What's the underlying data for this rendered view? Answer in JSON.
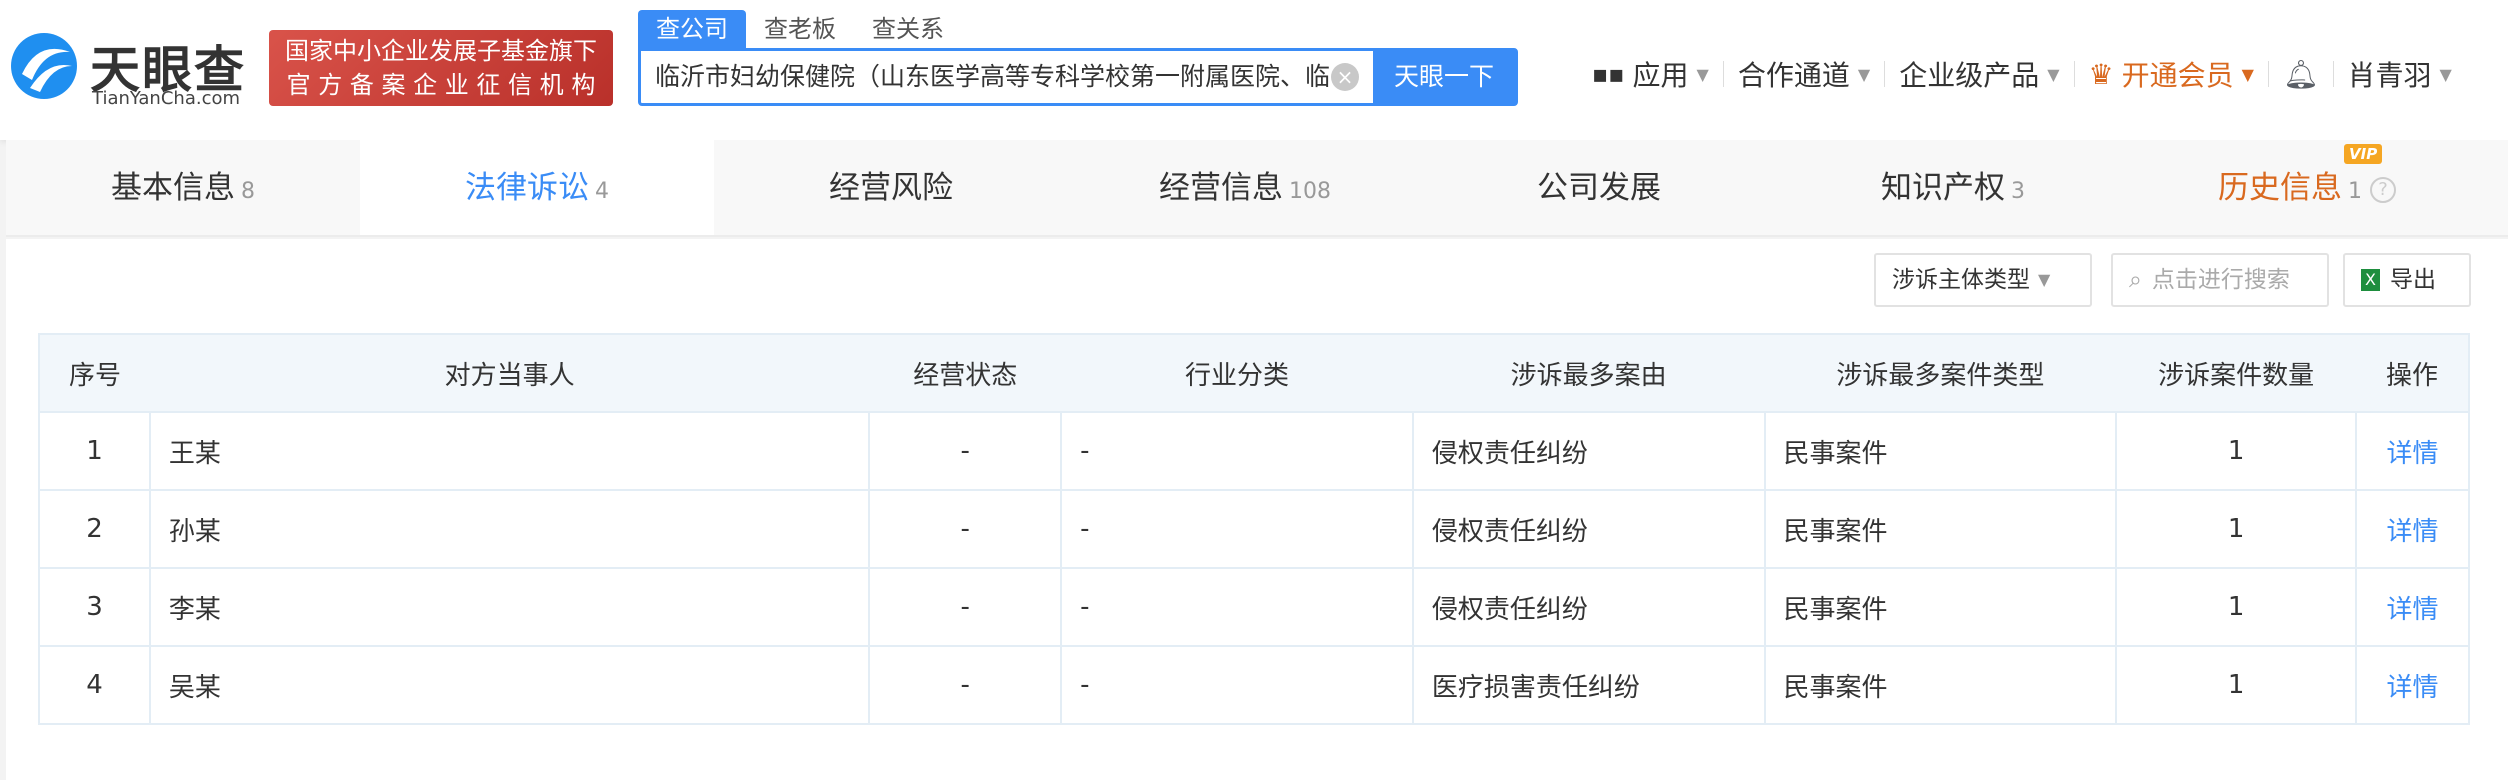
{
  "header": {
    "logo_text": "天眼查",
    "logo_url": "TianYanCha.com",
    "badge_line1": "国家中小企业发展子基金旗下",
    "badge_line2": "官 方 备 案 企 业 征 信 机 构",
    "search_tabs": [
      "查公司",
      "查老板",
      "查关系"
    ],
    "search_value": "临沂市妇幼保健院（山东医学高等专科学校第一附属医院、临沂",
    "search_button": "天眼一下",
    "nav": {
      "apps": "应用",
      "partner": "合作通道",
      "enterprise": "企业级产品",
      "vip": "开通会员",
      "user": "肖青羽"
    }
  },
  "tabs": [
    {
      "label": "基本信息",
      "count": "8"
    },
    {
      "label": "法律诉讼",
      "count": "4"
    },
    {
      "label": "经营风险",
      "count": ""
    },
    {
      "label": "经营信息",
      "count": "108"
    },
    {
      "label": "公司发展",
      "count": ""
    },
    {
      "label": "知识产权",
      "count": "3"
    },
    {
      "label": "历史信息",
      "count": "1",
      "badge": "VIP"
    }
  ],
  "toolbar": {
    "filter": "涉诉主体类型",
    "search_placeholder": "点击进行搜索",
    "export": "导出"
  },
  "table": {
    "headers": [
      "序号",
      "对方当事人",
      "经营状态",
      "行业分类",
      "涉诉最多案由",
      "涉诉最多案件类型",
      "涉诉案件数量",
      "操作"
    ],
    "rows": [
      [
        "1",
        "王某",
        "-",
        "-",
        "侵权责任纠纷",
        "民事案件",
        "1",
        "详情"
      ],
      [
        "2",
        "孙某",
        "-",
        "-",
        "侵权责任纠纷",
        "民事案件",
        "1",
        "详情"
      ],
      [
        "3",
        "李某",
        "-",
        "-",
        "侵权责任纠纷",
        "民事案件",
        "1",
        "详情"
      ],
      [
        "4",
        "吴某",
        "-",
        "-",
        "医疗损害责任纠纷",
        "民事案件",
        "1",
        "详情"
      ]
    ]
  },
  "colors": {
    "accent": "#3a8cf6",
    "vip": "#d9691f",
    "badge": "#c9403a"
  }
}
